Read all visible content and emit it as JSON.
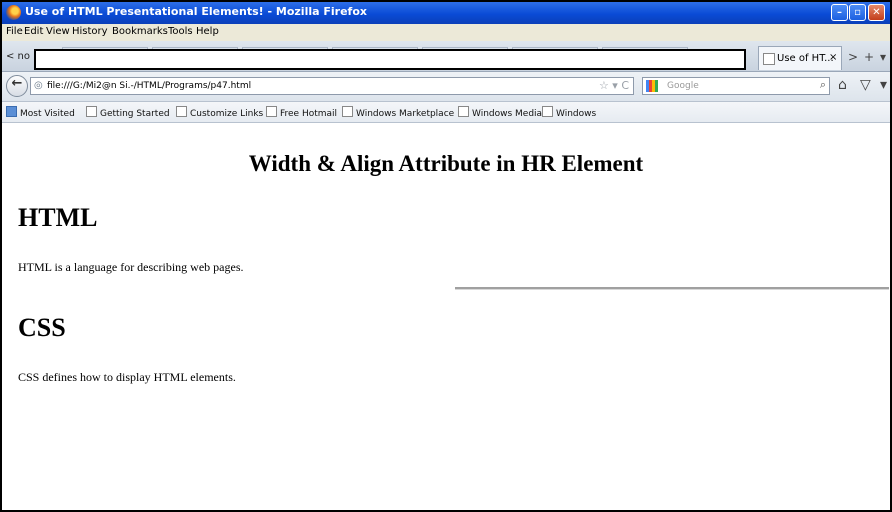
{
  "window": {
    "title": "Use of HTML Presentational Elements! - Mozilla Firefox",
    "min_label": "–",
    "max_label": "▫",
    "close_label": "✕"
  },
  "menu": {
    "items": [
      "File",
      "Edit",
      "View",
      "History",
      "Bookmarks",
      "Tools",
      "Help"
    ]
  },
  "tabs": {
    "back_tab_label": "< no",
    "active_tab_label": "Use of HT...",
    "active_tab_close": "×",
    "scroll_right": ">",
    "new_tab": "+",
    "list_tabs": "▾"
  },
  "navbar": {
    "back_label": "←",
    "url": "file:///G:/Mi2@n Si.-/HTML/Programs/p47.html",
    "url_icons": "☆ ▾ C",
    "search_placeholder": "Google",
    "search_icon": "⌕",
    "home_icon": "⌂",
    "pocket_icon": "▽",
    "menu_icon": "▾"
  },
  "bookmarks": {
    "items": [
      "Most Visited",
      "Getting Started",
      "Customize Links",
      "Free Hotmail",
      "Windows Marketplace",
      "Windows Media",
      "Windows"
    ]
  },
  "page": {
    "title": "Width & Align Attribute in HR Element",
    "html_heading": "HTML",
    "html_text": "HTML is a language for describing web pages.",
    "css_heading": "CSS",
    "css_text": "CSS defines how to display HTML elements."
  },
  "colors": {
    "titlebar": "#0a4bd6",
    "hr": "#a0a0a0"
  }
}
